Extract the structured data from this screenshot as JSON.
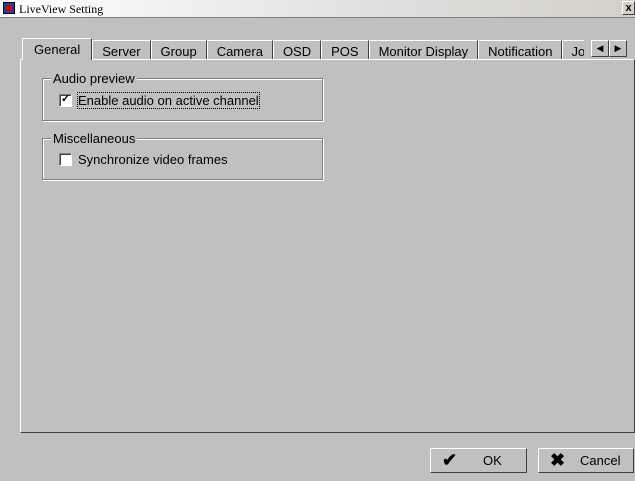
{
  "window": {
    "title": "LiveView Setting",
    "close_glyph": "x"
  },
  "tabs": [
    {
      "label": "General",
      "active": true
    },
    {
      "label": "Server"
    },
    {
      "label": "Group"
    },
    {
      "label": "Camera"
    },
    {
      "label": "OSD"
    },
    {
      "label": "POS"
    },
    {
      "label": "Monitor Display"
    },
    {
      "label": "Notification"
    },
    {
      "label": "Jo"
    }
  ],
  "tab_scroll": {
    "left_icon": "arrow-left-icon",
    "right_icon": "arrow-right-icon"
  },
  "general": {
    "audio_preview": {
      "title": "Audio preview",
      "enable_audio": {
        "label": "Enable audio on active channel",
        "checked": true
      }
    },
    "misc": {
      "title": "Miscellaneous",
      "sync_frames": {
        "label": "Synchronize video frames",
        "checked": false
      }
    }
  },
  "buttons": {
    "ok": {
      "label": "OK",
      "icon": "checkmark-icon"
    },
    "cancel": {
      "label": "Cancel",
      "icon": "x-icon"
    }
  }
}
